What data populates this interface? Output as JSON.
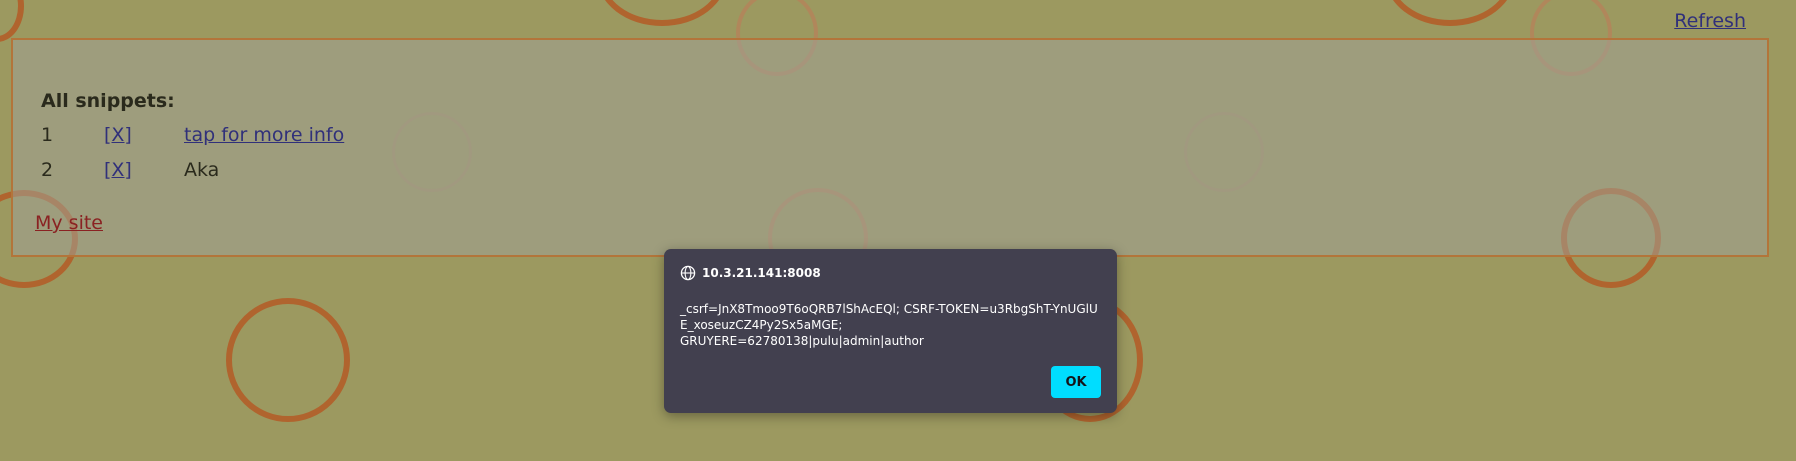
{
  "header": {
    "refresh_label": "Refresh"
  },
  "snippets": {
    "heading": "All snippets:",
    "rows": [
      {
        "number": "1",
        "delete_label": "[X]",
        "text": "tap for more info"
      },
      {
        "number": "2",
        "delete_label": "[X]",
        "text": "Aka"
      }
    ]
  },
  "footer": {
    "my_site_label": "My site"
  },
  "dialog": {
    "origin": "10.3.21.141:8008",
    "message": "_csrf=JnX8Tmoo9T6oQRB7lShAcEQl; CSRF-TOKEN=u3RbgShT-YnUGlUE_xoseuzCZ4Py2Sx5aMGE;\nGRUYERE=62780138|pulu|admin|author",
    "ok_label": "OK",
    "icon": "globe-icon"
  },
  "colors": {
    "background": "#9c9960",
    "ring": "#b0642e",
    "link": "#30307a",
    "my_site_link": "#8a2222",
    "dialog_bg": "#42404f",
    "ok_button": "#00ddff"
  }
}
